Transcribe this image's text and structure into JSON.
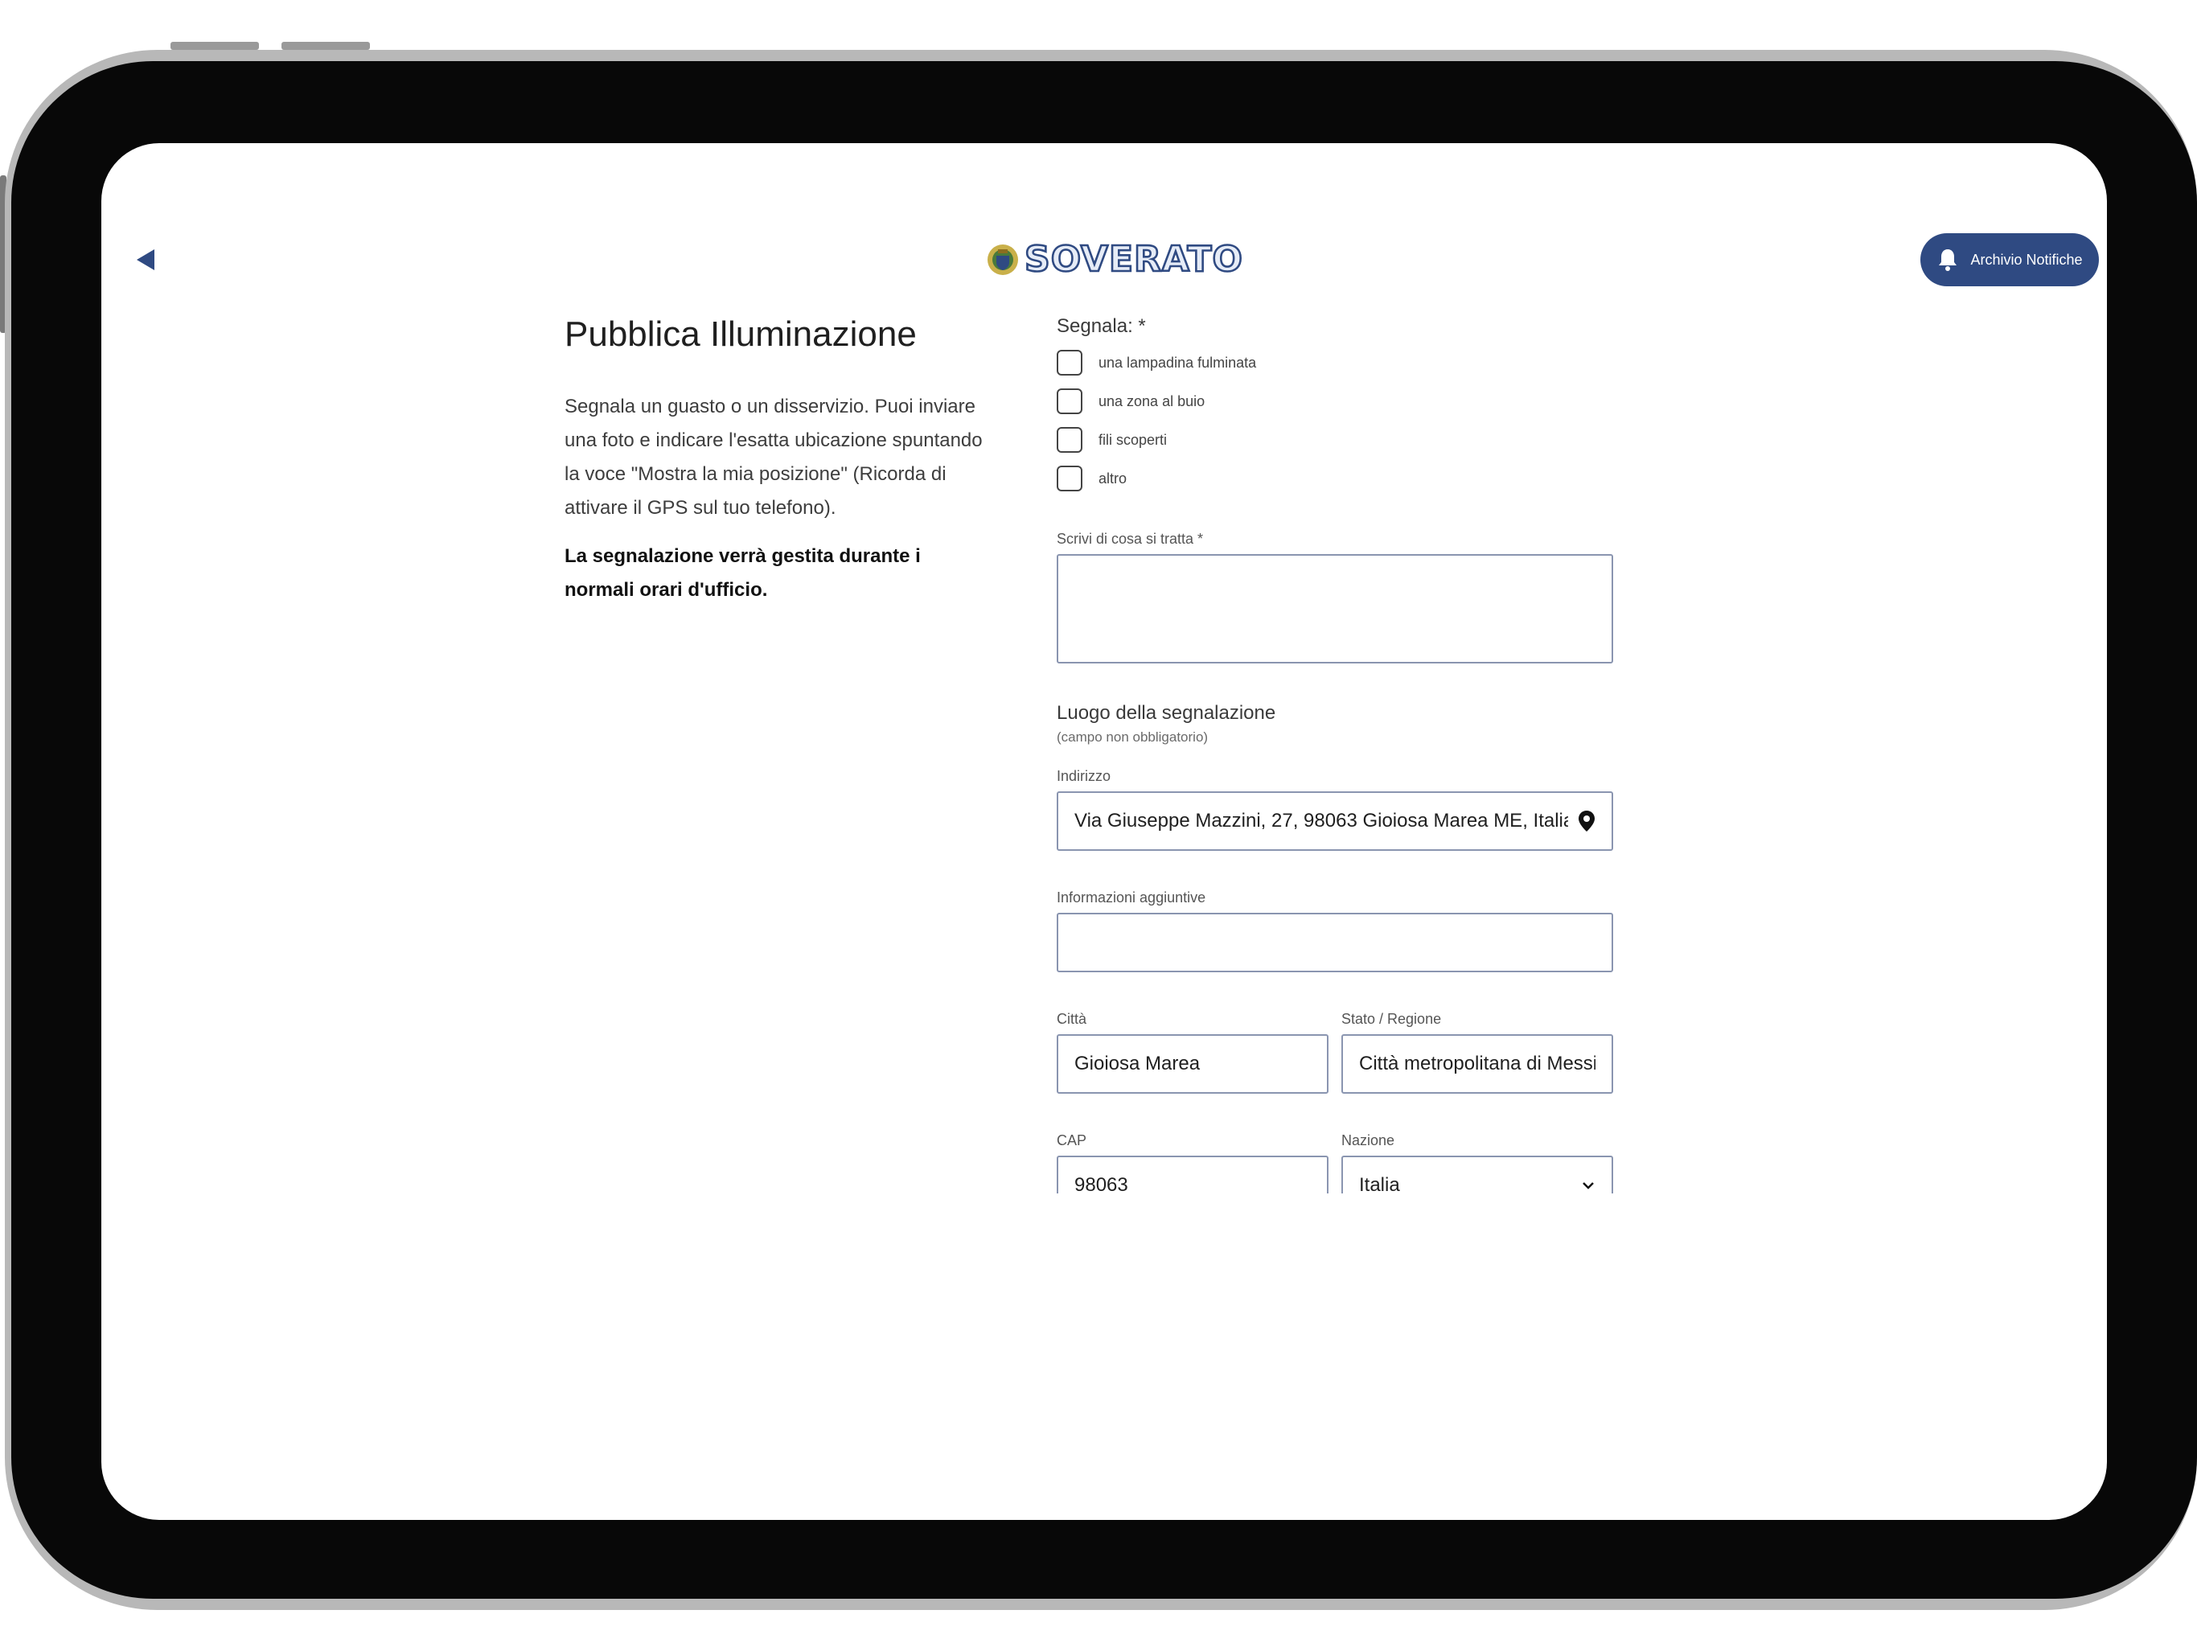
{
  "header": {
    "logo_text": "SOVERATO",
    "notif_button_label": "Archivio Notifiche"
  },
  "intro": {
    "title": "Pubblica Illuminazione",
    "description": "Segnala un guasto o un disservizio. Puoi inviare una foto e indicare l'esatta ubicazione spuntando la voce \"Mostra la mia posizione\" (Ricorda di attivare il GPS sul tuo telefono).",
    "note": "La segnalazione verrà gestita durante i normali orari d'ufficio."
  },
  "form": {
    "segnala_label": "Segnala: *",
    "options": [
      {
        "label": "una lampadina fulminata",
        "checked": false
      },
      {
        "label": "una zona al buio",
        "checked": false
      },
      {
        "label": "fili scoperti",
        "checked": false
      },
      {
        "label": "altro",
        "checked": false
      }
    ],
    "description_label": "Scrivi di cosa si tratta *",
    "description_value": "",
    "location_title": "Luogo della segnalazione",
    "location_subtitle": "(campo non obbligatorio)",
    "address_label": "Indirizzo",
    "address_value": "Via Giuseppe Mazzini, 27, 98063 Gioiosa Marea ME, Italia",
    "extra_label": "Informazioni aggiuntive",
    "extra_value": "",
    "city_label": "Città",
    "city_value": "Gioiosa Marea",
    "region_label": "Stato / Regione",
    "region_value": "Città metropolitana di Messina",
    "cap_label": "CAP",
    "cap_value": "98063",
    "country_label": "Nazione",
    "country_value": "Italia"
  },
  "colors": {
    "brand": "#2f4a82",
    "input_border": "#8a95b0"
  },
  "icons": [
    "back-arrow-icon",
    "bell-icon",
    "location-pin-icon",
    "chevron-down-icon",
    "crest-icon"
  ]
}
